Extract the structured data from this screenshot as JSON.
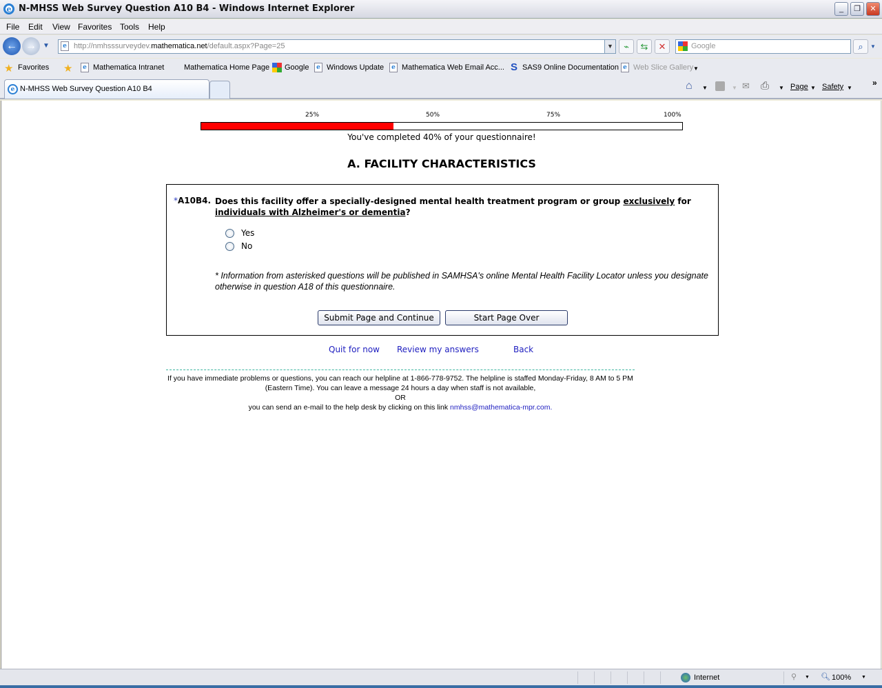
{
  "window": {
    "title": "N-MHSS Web Survey Question A10 B4 - Windows Internet Explorer"
  },
  "menu": [
    "File",
    "Edit",
    "View",
    "Favorites",
    "Tools",
    "Help"
  ],
  "address": {
    "prefix": "http://nmhsssurveydev.",
    "domain": "mathematica.net",
    "path": "/default.aspx?Page=25"
  },
  "search": {
    "placeholder": "Google"
  },
  "favorites": {
    "label": "Favorites",
    "items": [
      "Mathematica Intranet",
      "Mathematica Home Page",
      "Google",
      "Windows Update",
      "Mathematica Web Email Acc...",
      "SAS9 Online Documentation",
      "Web Slice Gallery"
    ]
  },
  "tab": {
    "title": "N-MHSS Web Survey Question A10 B4"
  },
  "commandbar": {
    "page": "Page",
    "safety": "Safety"
  },
  "progress": {
    "percent": 40,
    "ticks": [
      "25%",
      "50%",
      "75%",
      "100%"
    ],
    "message": "You've completed 40% of your questionnaire!",
    "fill_color": "#ff0000"
  },
  "section": "A. FACILITY CHARACTERISTICS",
  "question": {
    "asterisk": "*",
    "number": "A10B4.",
    "t1": "Does this facility offer a specially-designed mental health treatment program or group ",
    "u1": "exclusively",
    "t2": " for ",
    "u2": "individuals with Alzheimer's or dementia",
    "t3": "?",
    "options": [
      "Yes",
      "No"
    ]
  },
  "note": "* Information from asterisked questions will be published in SAMHSA's online Mental Health Facility Locator unless you designate otherwise in question A18 of this questionnaire.",
  "buttons": {
    "submit": "Submit Page and Continue",
    "start_over": "Start Page Over"
  },
  "links": {
    "quit": "Quit for now",
    "review": "Review my answers",
    "back": "Back"
  },
  "help": {
    "line1": "If you have immediate problems or questions, you can reach our helpline at 1-866-778-9752. The helpline is staffed Monday-Friday, 8 AM to 5 PM (Eastern Time). You can leave a message 24 hours a day when staff is not available,",
    "or": "OR",
    "line3": "you can send an e-mail to the help desk by clicking on this link ",
    "email": "nmhss@mathematica-mpr.com."
  },
  "status": {
    "zone": "Internet",
    "zoom": "100%"
  }
}
